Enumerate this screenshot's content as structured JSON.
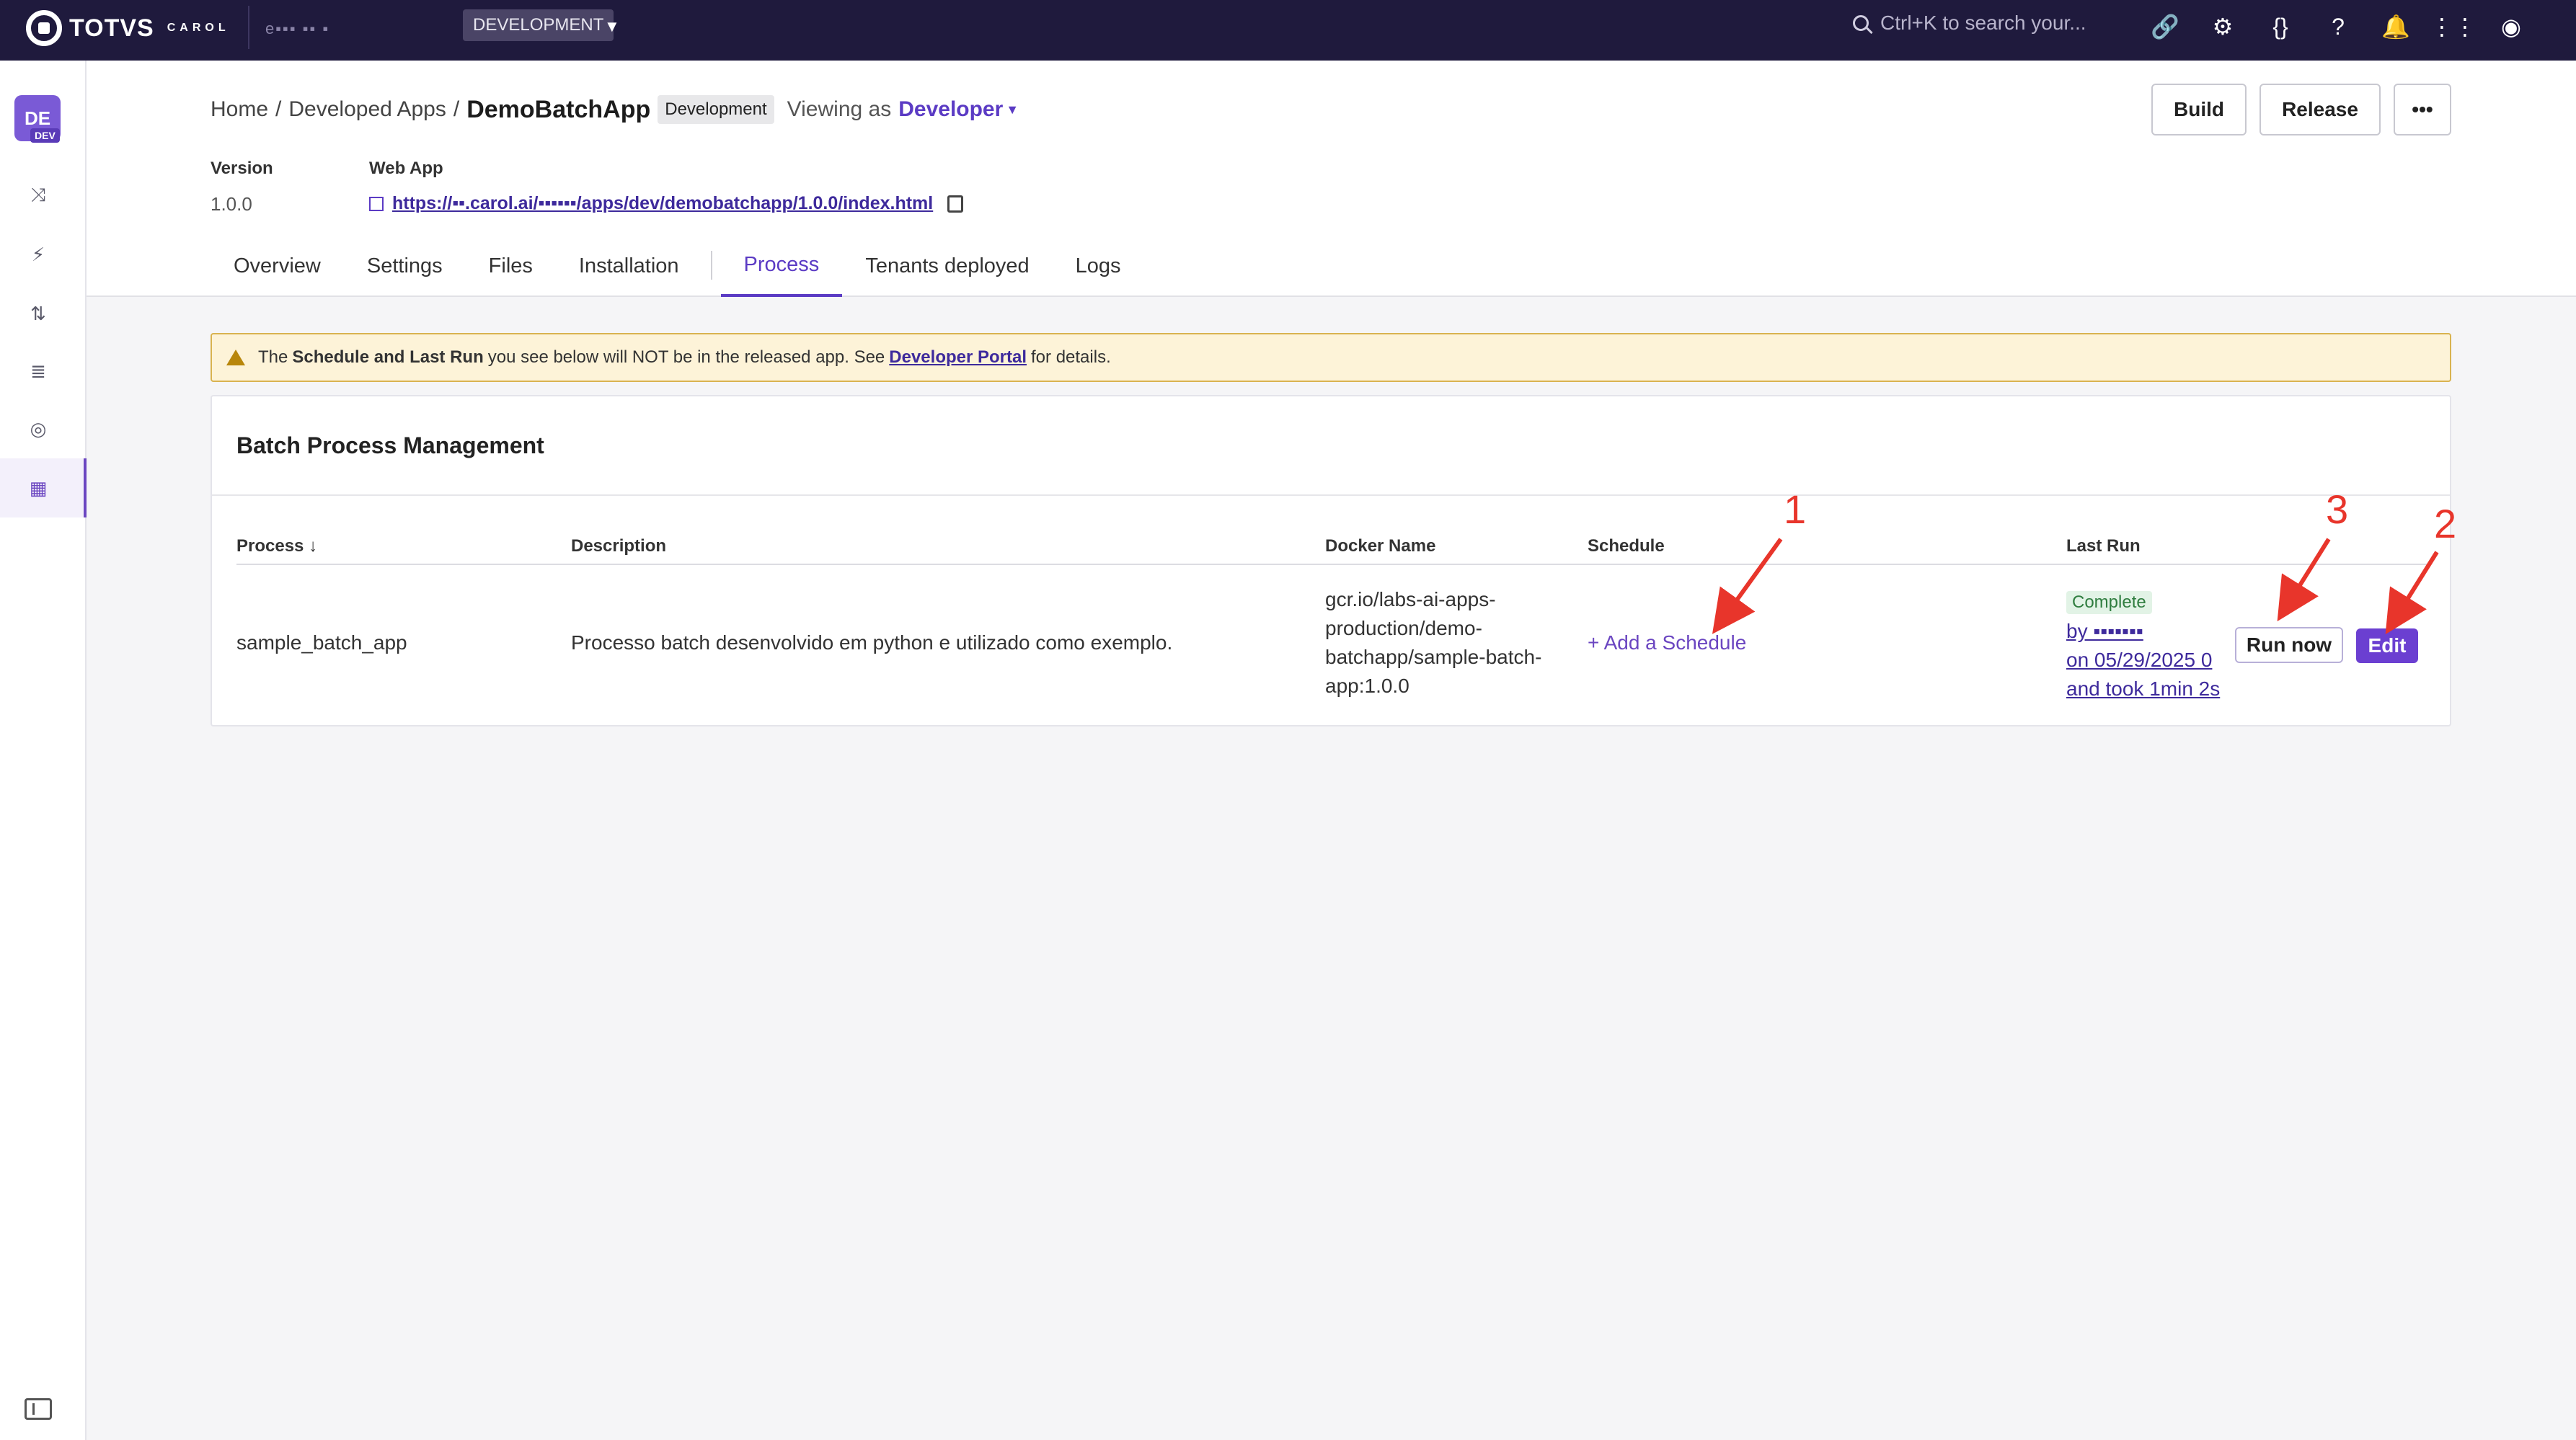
{
  "topbar": {
    "brand": "TOTVS",
    "brand_sub": "CAROL",
    "org_name_blurred": "e▪▪▪ ▪▪ ▪",
    "environment": "DEVELOPMENT",
    "search_placeholder": "Ctrl+K to search your...",
    "icons": [
      "link-icon",
      "gear-icon",
      "braces-icon",
      "help-icon",
      "bell-icon",
      "apps-grid-icon",
      "account-icon"
    ]
  },
  "sidebar": {
    "avatar_initials": "DE",
    "avatar_badge": "DEV"
  },
  "header": {
    "breadcrumb": {
      "home": "Home",
      "sep": "/",
      "developed_apps": "Developed Apps",
      "app_name": "DemoBatchApp",
      "env_chip": "Development",
      "viewing_as": "Viewing as",
      "role": "Developer"
    },
    "buttons": {
      "build": "Build",
      "release": "Release",
      "more": "•••"
    },
    "version_label": "Version",
    "version_value": "1.0.0",
    "webapp_label": "Web App",
    "webapp_url": "https://▪▪.carol.ai/▪▪▪▪▪▪/apps/dev/demobatchapp/1.0.0/index.html",
    "tabs": [
      "Overview",
      "Settings",
      "Files",
      "Installation",
      "Process",
      "Tenants deployed",
      "Logs"
    ]
  },
  "banner": {
    "pre": "The",
    "bold": "Schedule and Last Run",
    "mid": "you see below will NOT be in the released app. See",
    "link": "Developer Portal",
    "post": "for details."
  },
  "card": {
    "title": "Batch Process Management",
    "columns": {
      "process": "Process ↓",
      "description": "Description",
      "docker": "Docker Name",
      "schedule": "Schedule",
      "last_run": "Last Run"
    },
    "row": {
      "process": "sample_batch_app",
      "description": "Processo batch desenvolvido em python e utilizado como exemplo.",
      "docker": "gcr.io/labs-ai-apps-production/demo-batchapp/sample-batch-app:1.0.0",
      "schedule_action": "+ Add a Schedule",
      "status": "Complete",
      "last_run_by": "by ▪▪▪▪▪▪▪",
      "last_run_on": "on 05/29/2025 0",
      "last_run_took": "and took 1min 2s",
      "run_now": "Run now",
      "edit": "Edit"
    }
  },
  "annotations": {
    "one": "1",
    "two": "2",
    "three": "3"
  },
  "colors": {
    "accent": "#6b46c1",
    "topbar": "#1f1a3d",
    "annotation": "#e8352b"
  }
}
